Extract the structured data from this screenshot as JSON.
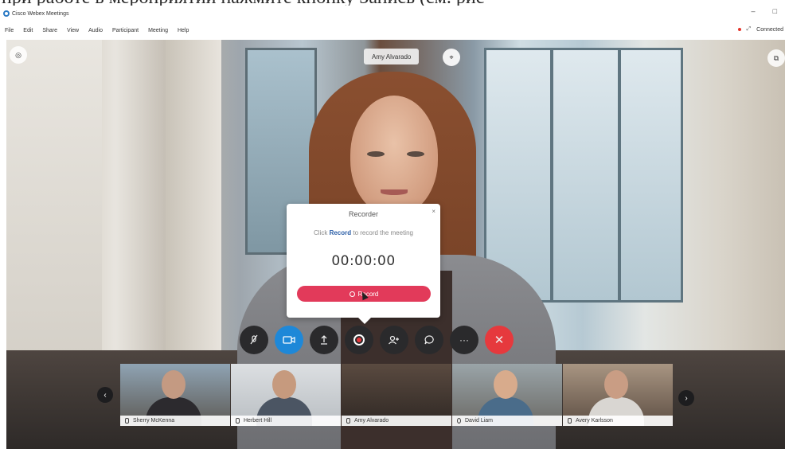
{
  "page_caption": "при работе в мероприятии нажмите кнопку Запись (см. рис",
  "window": {
    "title": "Cisco Webex Meetings",
    "controls": [
      "–",
      "□"
    ]
  },
  "menu": [
    "File",
    "Edit",
    "Share",
    "View",
    "Audio",
    "Participant",
    "Meeting",
    "Help"
  ],
  "status": {
    "connection": "Connected"
  },
  "active_speaker": {
    "name": "Amy Alvarado"
  },
  "recorder": {
    "title": "Recorder",
    "close": "×",
    "hint_prefix": "Click ",
    "hint_bold": "Record",
    "hint_suffix": " to record the meeting",
    "timer": "00:00:00",
    "button_label": "Record"
  },
  "controls": {
    "mute_icon": "mic-off-icon",
    "video_icon": "video-icon",
    "share_icon": "share-icon",
    "record_icon": "record-icon",
    "participants_icon": "participants-icon",
    "chat_icon": "chat-icon",
    "more_label": "···",
    "end_label": "✕"
  },
  "participants": [
    {
      "name": "Sherry McKenna"
    },
    {
      "name": "Herbert Hill"
    },
    {
      "name": "Amy Alvarado"
    },
    {
      "name": "David Liam"
    },
    {
      "name": "Avery Karlsson"
    }
  ],
  "colors": {
    "accent": "#1e88d8",
    "record": "#e23a5a",
    "end_call": "#e6393d"
  }
}
